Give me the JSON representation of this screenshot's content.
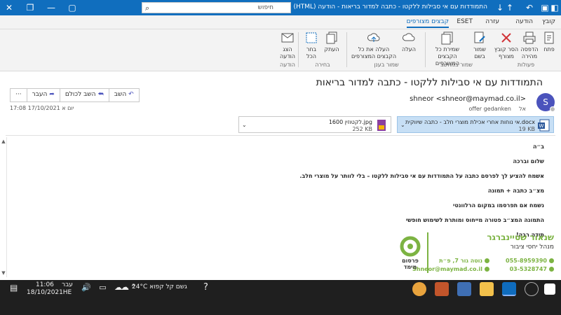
{
  "window": {
    "title": "התמודדות עם אי סבילות ללקטו - כתבה למדור בריאות - הודעה (HTML)",
    "search_placeholder": "חיפוש"
  },
  "ribbon_tabs": [
    "קובץ",
    "הודעה",
    "עזרה",
    "ESET",
    "קבצים מצורפים"
  ],
  "ribbon": {
    "buttons": [
      {
        "label": "פתח",
        "icon": "open-icon"
      },
      {
        "label": "הדפסה מהירה",
        "icon": "print-icon"
      },
      {
        "label": "הסר קובץ מצורף",
        "icon": "remove-attachment-icon"
      },
      {
        "label": "שמור בשם",
        "icon": "save-as-icon"
      },
      {
        "label": "שמירת כל הקבצים המצורפים",
        "icon": "save-all-icon"
      },
      {
        "label": "העלה",
        "icon": "cloud-upload-icon"
      },
      {
        "label": "העלה את כל הקבצים המצורפים",
        "icon": "cloud-upload-all-icon"
      },
      {
        "label": "העתק",
        "icon": "copy-icon"
      },
      {
        "label": "בחר הכל",
        "icon": "select-all-icon"
      },
      {
        "label": "הצג הודעה",
        "icon": "show-message-icon"
      }
    ],
    "groups": [
      "פעולות",
      "שמור במחשב",
      "שמור בענן",
      "בחירה",
      "הודעה"
    ]
  },
  "message": {
    "subject": "התמודדות עם אי סבילות ללקטו - כתבה למדור בריאות",
    "sender": "shneor <shneor@maymad.co.il>",
    "to_label": "אל",
    "to_name": "offer gedanken",
    "avatar_initial": "S",
    "date": "יום א 17/10/2021 17:08",
    "actions": {
      "reply": "השב",
      "reply_all": "השב לכולם",
      "forward": "העבר",
      "more": "···"
    },
    "attachments": [
      {
        "name": "אי נוחות אחרי אכילת מוצרי חלב - כתבה שיווקית.docx",
        "size": "19 KB"
      },
      {
        "name": "לקטוזין 1600.jpg",
        "size": "252 KB"
      }
    ],
    "body": [
      "ב״ה",
      "שלום וברכה",
      "אשמח להציע לך לפרסם כתבה על התמודדות עם אי סבילות ללקטו – בלי לוותר על מוצרי חלב.",
      "מצ״ב כתבה + תמונה",
      "נשמח אם תפרסמו במקום הרלוונטי",
      "התמונה המצ״ב פטורה מייחוס ומותרת לשימוש חופשי",
      "תודה רבה!"
    ],
    "signature": {
      "name": "שנאור שטיינברגר",
      "role": "מנהל יחסי ציבור",
      "phone1": "055-8959390",
      "phone2": "03-5328747",
      "address": "נוטה גור 7, פ״ת",
      "email": "Shneor@maymad.co.il",
      "logo_text": "פרסום מימד"
    }
  },
  "taskbar": {
    "weather": "24°C  גשם קל קפוא",
    "time": "11:06",
    "date": "18/10/2021",
    "lang1": "עבר",
    "lang2": "HE"
  },
  "colors": {
    "accent": "#106ebe",
    "green": "#7cb342",
    "avatar": "#4b53bc"
  }
}
